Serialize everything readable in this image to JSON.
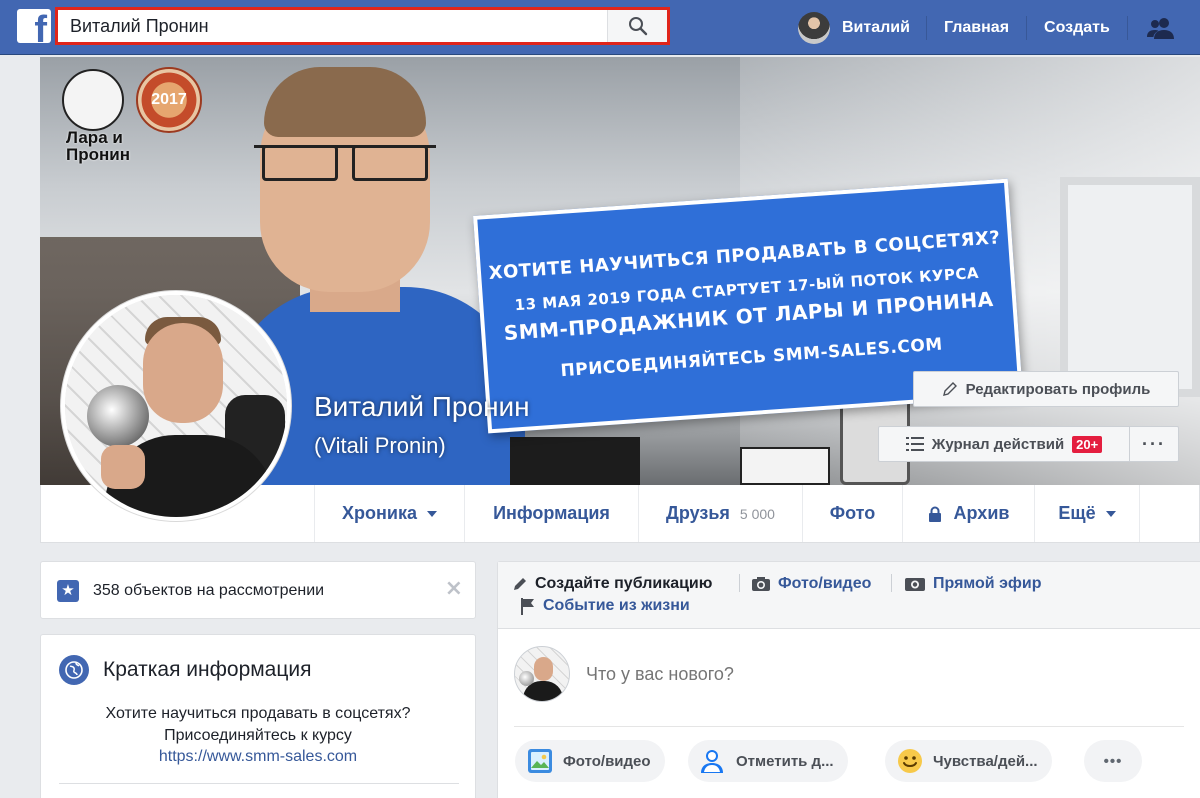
{
  "topbar": {
    "logo": "f",
    "search": {
      "value": "Виталий Пронин",
      "icon": "search-icon"
    },
    "user_name": "Виталий",
    "home_label": "Главная",
    "create_label": "Создать",
    "friends_icon": "friend-requests-icon",
    "colors": {
      "bar": "#4267b2",
      "search_outline": "#e0251b"
    }
  },
  "cover": {
    "logo_text_line1": "Лара и",
    "logo_text_line2": "Пронин",
    "medal_text": "2017",
    "banner": {
      "line1": "Хотите научиться продавать в соцсетях?",
      "line2": "13 мая 2019 года стартует 17-ый поток курса",
      "line3": "SMM-продажник от Лары и Пронина",
      "line4": "Присоединяйтесь smm-sales.com"
    },
    "name": "Виталий Пронин",
    "alt_name": "(Vitali Pronin)",
    "edit_button": "Редактировать профиль",
    "activity_log_button": "Журнал действий",
    "activity_badge": "20+",
    "more_button": "···"
  },
  "tabs": [
    {
      "label": "Хроника",
      "dropdown": true
    },
    {
      "label": "Информация"
    },
    {
      "label": "Друзья",
      "count": "5 000"
    },
    {
      "label": "Фото"
    },
    {
      "label": "Архив",
      "icon": "lock-icon"
    },
    {
      "label": "Ещё",
      "dropdown": true
    }
  ],
  "review": {
    "text": "358 объектов на рассмотрении",
    "close": "×"
  },
  "intro": {
    "title": "Краткая информация",
    "line1": "Хотите научиться продавать в соцсетях?",
    "line2": "Присоединяйтесь к курсу",
    "link": "https://www.smm-sales.com"
  },
  "composer": {
    "head": {
      "create_post": "Создайте публикацию",
      "photo_video": "Фото/видео",
      "live": "Прямой эфир",
      "life_event": "Событие из жизни"
    },
    "placeholder": "Что у вас нового?",
    "actions": {
      "photo_video": "Фото/видео",
      "tag": "Отметить д...",
      "feeling": "Чувства/дей...",
      "more": "•••"
    }
  }
}
